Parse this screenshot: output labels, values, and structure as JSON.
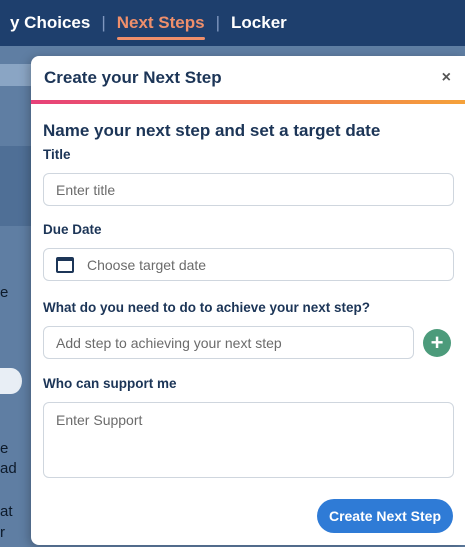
{
  "nav": {
    "items": [
      {
        "label": "y Choices"
      },
      {
        "label": "Next Steps"
      },
      {
        "label": "Locker"
      }
    ],
    "separator": "|",
    "active_color": "#ef8f6b"
  },
  "background": {
    "side_texts": [
      "e",
      "e",
      "ad",
      "at",
      "r"
    ]
  },
  "modal": {
    "title": "Create your Next Step",
    "close_label": "×",
    "heading": "Name your next step and set a target date",
    "title_field": {
      "label": "Title",
      "placeholder": "Enter title"
    },
    "due_date": {
      "label": "Due Date",
      "placeholder": "Choose target date",
      "icon": "calendar-icon"
    },
    "steps": {
      "label": "What do you need to do to achieve your next step?",
      "placeholder": "Add step to achieving your next step",
      "add_icon": "+"
    },
    "support": {
      "label": "Who can support me",
      "placeholder": "Enter Support"
    },
    "submit_label": "Create Next Step",
    "colors": {
      "primary": "#2f7bd6",
      "add": "#4c9b7b",
      "heading": "#1c3557"
    }
  }
}
